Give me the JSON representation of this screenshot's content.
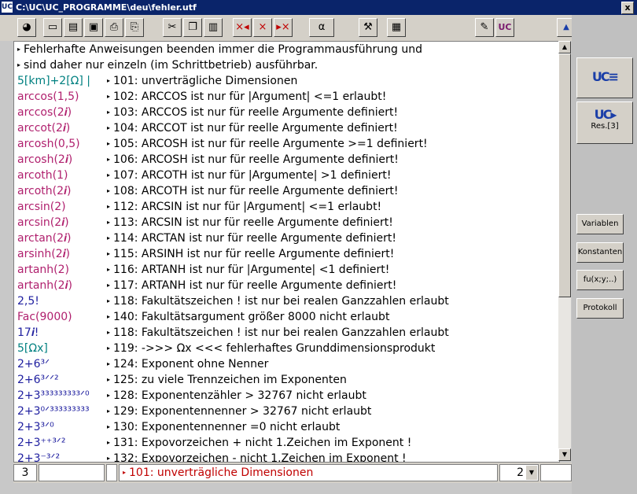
{
  "window": {
    "title": "C:\\UC\\UC_PROGRAMME\\deu\\fehler.utf",
    "close": "x"
  },
  "toolbar": {
    "buttons": [
      {
        "icon": "globe-icon",
        "glyph": "◕"
      },
      {
        "icon": "open-folder-icon",
        "glyph": "▭"
      },
      {
        "icon": "new-file-icon",
        "glyph": "▤"
      },
      {
        "icon": "save-icon",
        "glyph": "▣"
      },
      {
        "icon": "print-icon",
        "glyph": "⎙"
      },
      {
        "icon": "printer-setup-icon",
        "glyph": "⎘"
      },
      {
        "icon": "cut-icon",
        "glyph": "✂"
      },
      {
        "icon": "copy-icon",
        "glyph": "❐"
      },
      {
        "icon": "paste-icon",
        "glyph": "▥"
      },
      {
        "icon": "delete-left-icon",
        "glyph": "×◂"
      },
      {
        "icon": "delete-icon",
        "glyph": "×"
      },
      {
        "icon": "delete-right-icon",
        "glyph": "▸×"
      },
      {
        "icon": "alpha-icon",
        "glyph": "α"
      },
      {
        "icon": "tools-icon",
        "glyph": "⚒"
      },
      {
        "icon": "bus-icon",
        "glyph": "▦"
      },
      {
        "icon": "brush-icon",
        "glyph": "✎"
      },
      {
        "icon": "uc-logo-icon",
        "glyph": "UC"
      },
      {
        "icon": "scroll-up-icon",
        "glyph": "▲"
      }
    ]
  },
  "editor": {
    "intro": [
      "Fehlerhafte Anweisungen beenden immer die Programmausführung und",
      "sind daher nur einzeln (im Schrittbetrieb) ausführbar."
    ],
    "rows": [
      {
        "expr": "5[km]+2[Ω] |",
        "color": "#008080",
        "msg": "101: unverträgliche Dimensionen"
      },
      {
        "expr": "arccos(1,5)",
        "color": "#b0206e",
        "msg": "102: ARCCOS ist nur für |Argument| <=1 erlaubt!"
      },
      {
        "expr": "arccos(2𝒊)",
        "color": "#b0206e",
        "msg": "103: ARCCOS ist nur für reelle Argumente definiert!"
      },
      {
        "expr": "arccot(2𝒊)",
        "color": "#b0206e",
        "msg": "104: ARCCOT ist nur für reelle Argumente definiert!"
      },
      {
        "expr": "arcosh(0,5)",
        "color": "#b0206e",
        "msg": "105: ARCOSH ist nur für reelle Argumente >=1 definiert!"
      },
      {
        "expr": "arcosh(2𝒊)",
        "color": "#b0206e",
        "msg": "106: ARCOSH ist nur für reelle Argumente definiert!"
      },
      {
        "expr": "arcoth(1)",
        "color": "#b0206e",
        "msg": "107: ARCOTH ist nur für |Argumente| >1 definiert!"
      },
      {
        "expr": "arcoth(2𝒊)",
        "color": "#b0206e",
        "msg": "108: ARCOTH ist nur für reelle Argumente definiert!"
      },
      {
        "expr": "arcsin(2)",
        "color": "#b0206e",
        "msg": "112: ARCSIN ist nur für |Argument| <=1 erlaubt!"
      },
      {
        "expr": "arcsin(2𝒊)",
        "color": "#b0206e",
        "msg": "113: ARCSIN ist nur für reelle Argumente definiert!"
      },
      {
        "expr": "arctan(2𝒊)",
        "color": "#b0206e",
        "msg": "114: ARCTAN ist nur für reelle Argumente definiert!"
      },
      {
        "expr": "arsinh(2𝒊)",
        "color": "#b0206e",
        "msg": "115: ARSINH ist nur für reelle Argumente definiert!"
      },
      {
        "expr": "artanh(2)",
        "color": "#b0206e",
        "msg": "116: ARTANH ist nur für |Argumente| <1 definiert!"
      },
      {
        "expr": "artanh(2𝒊)",
        "color": "#b0206e",
        "msg": "117: ARTANH ist nur für reelle Argumente definiert!"
      },
      {
        "expr": "2,5!",
        "color": "#2020a0",
        "msg": "118: Fakultätszeichen ! ist nur bei realen Ganzzahlen erlaubt"
      },
      {
        "expr": "Fac(9000)",
        "color": "#b0206e",
        "msg": "140: Fakultätsargument größer 8000 nicht erlaubt"
      },
      {
        "expr": "17𝒊!",
        "color": "#2020a0",
        "msg": "118: Fakultätszeichen ! ist nur bei realen Ganzzahlen erlaubt"
      },
      {
        "expr": "5[Ωx]",
        "color": "#008080",
        "msg": "119: ->>> Ωx <<< fehlerhaftes Grunddimensionsprodukt"
      },
      {
        "expr": "2+6³ᐟ",
        "color": "#2020a0",
        "msg": "124: Exponent ohne Nenner"
      },
      {
        "expr": "2+6³ᐟᐟ²",
        "color": "#2020a0",
        "msg": "125: zu viele Trennzeichen im Exponenten"
      },
      {
        "expr": "2+3³³³³³³³³³ᐟ⁰",
        "color": "#2020a0",
        "msg": "128: Exponentenzähler > 32767 nicht erlaubt"
      },
      {
        "expr": "2+3⁰ᐟ³³³³³³³³³",
        "color": "#2020a0",
        "msg": "129: Exponentennenner > 32767 nicht erlaubt"
      },
      {
        "expr": "2+3³ᐟ⁰",
        "color": "#2020a0",
        "msg": "130: Exponentennenner =0 nicht erlaubt"
      },
      {
        "expr": "2+3⁺⁺³ᐟ²",
        "color": "#2020a0",
        "msg": "131: Expovorzeichen + nicht 1.Zeichen im Exponent !"
      },
      {
        "expr": "2+3⁻³ᐟ²",
        "color": "#2020a0",
        "msg": "132: Expovorzeichen - nicht 1.Zeichen im Exponent !"
      }
    ]
  },
  "statusbar": {
    "line": "3",
    "field2": "",
    "field3": "",
    "message": "101: unverträgliche Dimensionen",
    "result_count": "2"
  },
  "rightpanel": {
    "btn1_logo": "UC≡",
    "btn2_logo": "UC▸",
    "btn2_label": "Res.[3]",
    "variablen": "Variablen",
    "konstanten": "Konstanten",
    "fu": "fu(x;y;..)",
    "protokoll": "Protokoll"
  }
}
